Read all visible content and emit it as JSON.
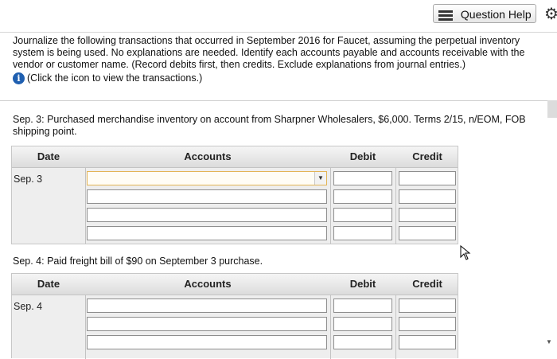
{
  "header": {
    "help_label": "Question Help",
    "settings_icon": "gear-icon"
  },
  "instructions": {
    "text": "Journalize the following transactions that occurred in September 2016 for Faucet, assuming the perpetual inventory system is being used. No explanations are needed. Identify each accounts payable and accounts receivable with the vendor or customer name. (Record debits first, then credits. Exclude explanations from journal entries.)",
    "info_label": "(Click the icon to view the transactions.)",
    "info_icon": "info-icon"
  },
  "journal_columns": {
    "date": "Date",
    "accounts": "Accounts",
    "debit": "Debit",
    "credit": "Credit"
  },
  "entries": [
    {
      "prompt": "Sep. 3: Purchased merchandise inventory on account from Sharpner Wholesalers, $6,000. Terms 2/15, n/EOM, FOB shipping point.",
      "date": "Sep. 3"
    },
    {
      "prompt": "Sep. 4: Paid freight bill of $90 on September 3 purchase.",
      "date": "Sep. 4"
    }
  ],
  "colors": {
    "info_blue": "#1f5fb0",
    "active_field_border": "#e3b455"
  }
}
